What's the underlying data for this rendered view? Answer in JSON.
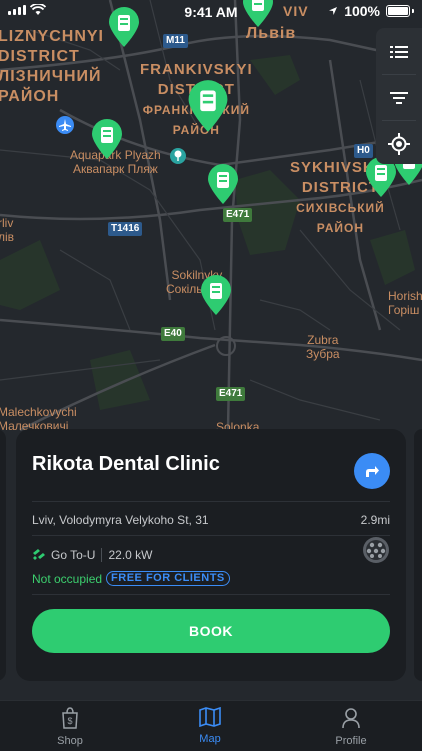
{
  "status_bar": {
    "time": "9:41 AM",
    "battery": "100%"
  },
  "map": {
    "districts": [
      {
        "id": "zaliz",
        "lines": [
          "LIZNYCHNYI",
          "DISTRICT",
          "ЛІЗНИЧНИЙ",
          "РАЙОН"
        ]
      },
      {
        "id": "frank",
        "lines": [
          "FRANKIVSKYI",
          "DISTRICT",
          "ФРАНКІВСЬКИЙ",
          "РАЙОН"
        ]
      },
      {
        "id": "sykh",
        "lines": [
          "SYKHIVSKYI",
          "DISTRICT",
          "СИХІВСЬКИЙ",
          "РАЙОН"
        ]
      }
    ],
    "labels": {
      "lviv": "Львів",
      "viv": "VIV",
      "aquapark_en": "Aquapark Plyazh",
      "aquapark_ua": "Аквапарк Пляж",
      "sokilnyky_en": "Sokilnyky",
      "sokilnyky_ua": "Сокільники",
      "zubra_en": "Zubra",
      "zubra_ua": "Зубра",
      "horish_en": "Horish",
      "horish_ua": "Горіш",
      "malechkovychi_en": "Malechkovychi",
      "malechkovychi_ua": "Малечковичі",
      "solonka": "Solonka",
      "rliv_en": "rliv",
      "rliv_ua": "лів"
    },
    "roads": {
      "m11": "M11",
      "t1416": "T1416",
      "e471_top": "E471",
      "e471_bottom": "E471",
      "e40": "E40",
      "h0": "H0"
    },
    "accent": "#2ecc71"
  },
  "controls": {
    "list_icon": "list-icon",
    "filter_icon": "filter-icon",
    "locate_icon": "locate-icon"
  },
  "station_card": {
    "title": "Rikota Dental Clinic",
    "address": "Lviv, Volodymyra Velykoho St, 31",
    "distance": "2.9mi",
    "provider": "Go To-U",
    "power": "22.0 kW",
    "status": "Not occupied",
    "tag": "FREE FOR CLIENTS",
    "book_label": "BOOK"
  },
  "tabs": [
    {
      "label": "Shop",
      "icon": "shopping-bag-icon"
    },
    {
      "label": "Map",
      "icon": "map-icon"
    },
    {
      "label": "Profile",
      "icon": "profile-icon"
    }
  ],
  "colors": {
    "primary": "#2ecc71",
    "link": "#3b8cf5",
    "map_label": "#c98e63"
  }
}
